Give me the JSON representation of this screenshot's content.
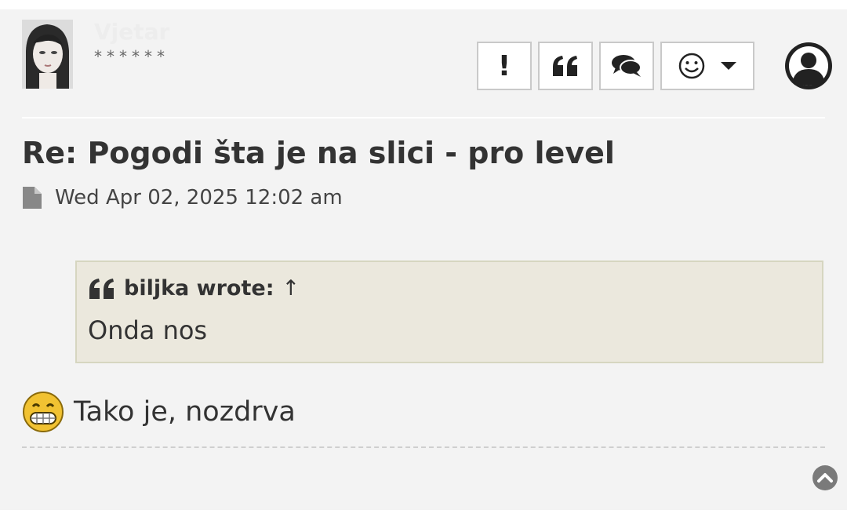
{
  "post": {
    "author": "Vjetar",
    "rank": "******",
    "title": "Re: Pogodi šta je na slici - pro level",
    "date": "Wed Apr 02, 2025 12:02 am",
    "quote": {
      "cite": "biljka wrote:",
      "arrow": "↑",
      "text": "Onda nos"
    },
    "reply": "Tako je, nozdrva"
  },
  "actions": {
    "report_icon": "exclamation-icon",
    "quote_icon": "quote-icon",
    "pm_icon": "comments-icon",
    "react_icon": "smiley-icon",
    "profile_icon": "user-circle-icon",
    "back_to_top_icon": "chevron-up-circle-icon"
  },
  "colors": {
    "post_bg": "#f3f3f3",
    "quote_bg": "#ebe8dd",
    "text": "#333333"
  }
}
